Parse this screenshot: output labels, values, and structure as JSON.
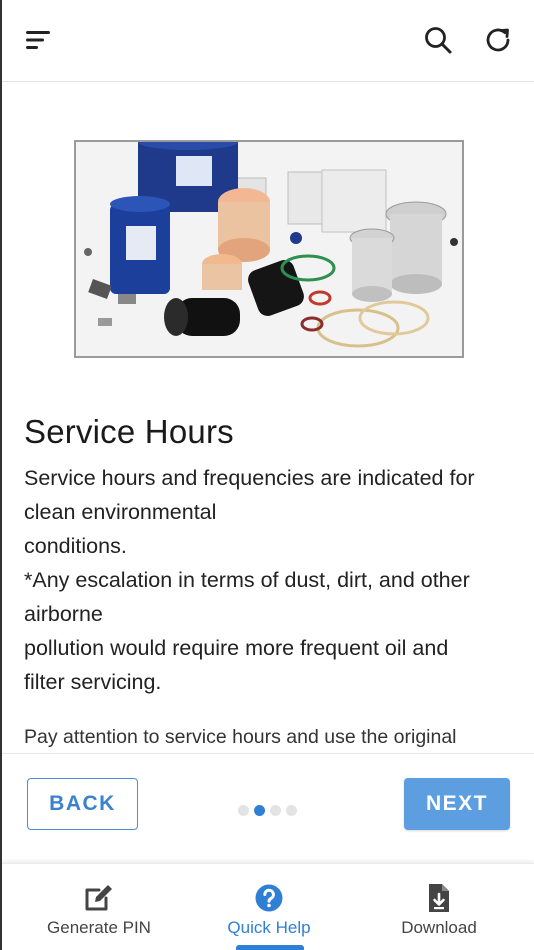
{
  "topbar": {
    "menu_icon": "menu-icon",
    "search_icon": "search-icon",
    "refresh_icon": "refresh-icon"
  },
  "slide": {
    "title": "Service Hours",
    "description_lines": [
      "Service hours and frequencies are indicated for",
      "clean environmental",
      "conditions.",
      "*Any escalation in terms of dust, dirt, and other",
      "airborne",
      "pollution would require more frequent oil and",
      "filter servicing."
    ],
    "note": "Pay attention to service hours and use the original"
  },
  "pager": {
    "back_label": "BACK",
    "next_label": "NEXT",
    "total_pages": 4,
    "current_page": 2
  },
  "bottom_nav": {
    "items": [
      {
        "label": "Generate PIN",
        "icon": "edit-icon"
      },
      {
        "label": "Quick Help",
        "icon": "help-circle-icon",
        "active": true
      },
      {
        "label": "Download",
        "icon": "download-file-icon"
      }
    ]
  },
  "colors": {
    "accent": "#2f7fd4",
    "next_button": "#5c9ee0",
    "back_border": "#4a90d9"
  }
}
